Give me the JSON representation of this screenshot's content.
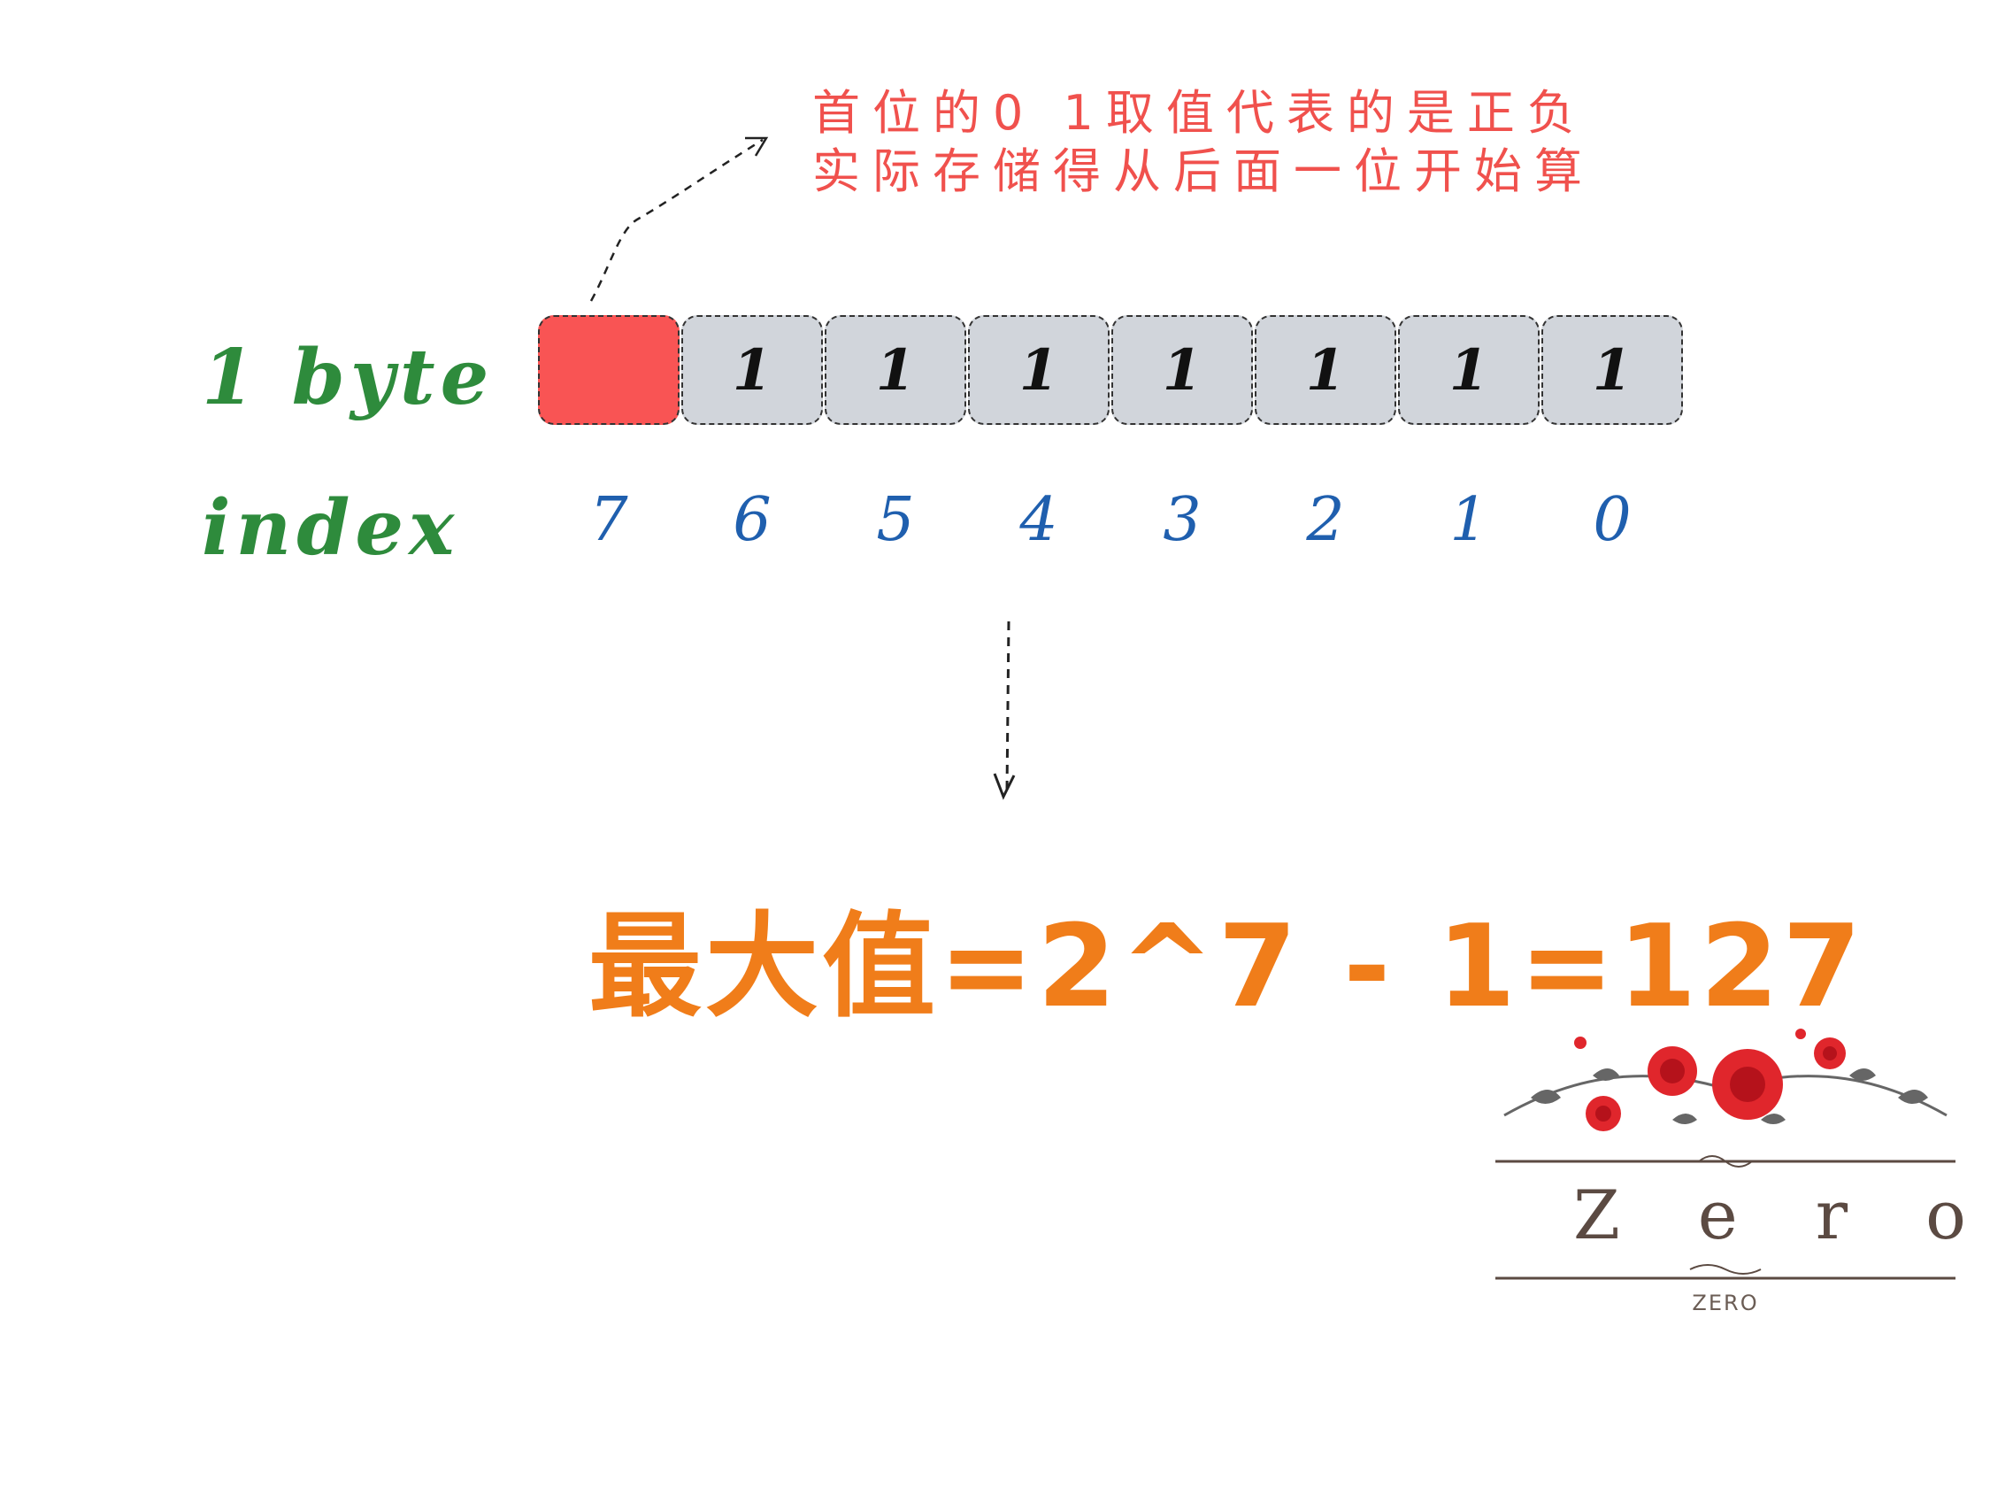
{
  "annotation": {
    "line1": "首位的0 1取值代表的是正负",
    "line2": "实际存储得从后面一位开始算"
  },
  "labels": {
    "byte": "1 byte",
    "index": "index"
  },
  "bits": [
    "",
    "1",
    "1",
    "1",
    "1",
    "1",
    "1",
    "1"
  ],
  "indices": [
    "7",
    "6",
    "5",
    "4",
    "3",
    "2",
    "1",
    "0"
  ],
  "formula": "最大值=2^7 - 1=127",
  "logo": {
    "word": "Zero",
    "sub": "ZERO"
  },
  "colors": {
    "sign_bit": "#f95454",
    "bit_cell": "#d1d5db",
    "annotation": "#f0514d",
    "row_label": "#2e8b3c",
    "index": "#1f5fae",
    "formula": "#f07d1a"
  }
}
